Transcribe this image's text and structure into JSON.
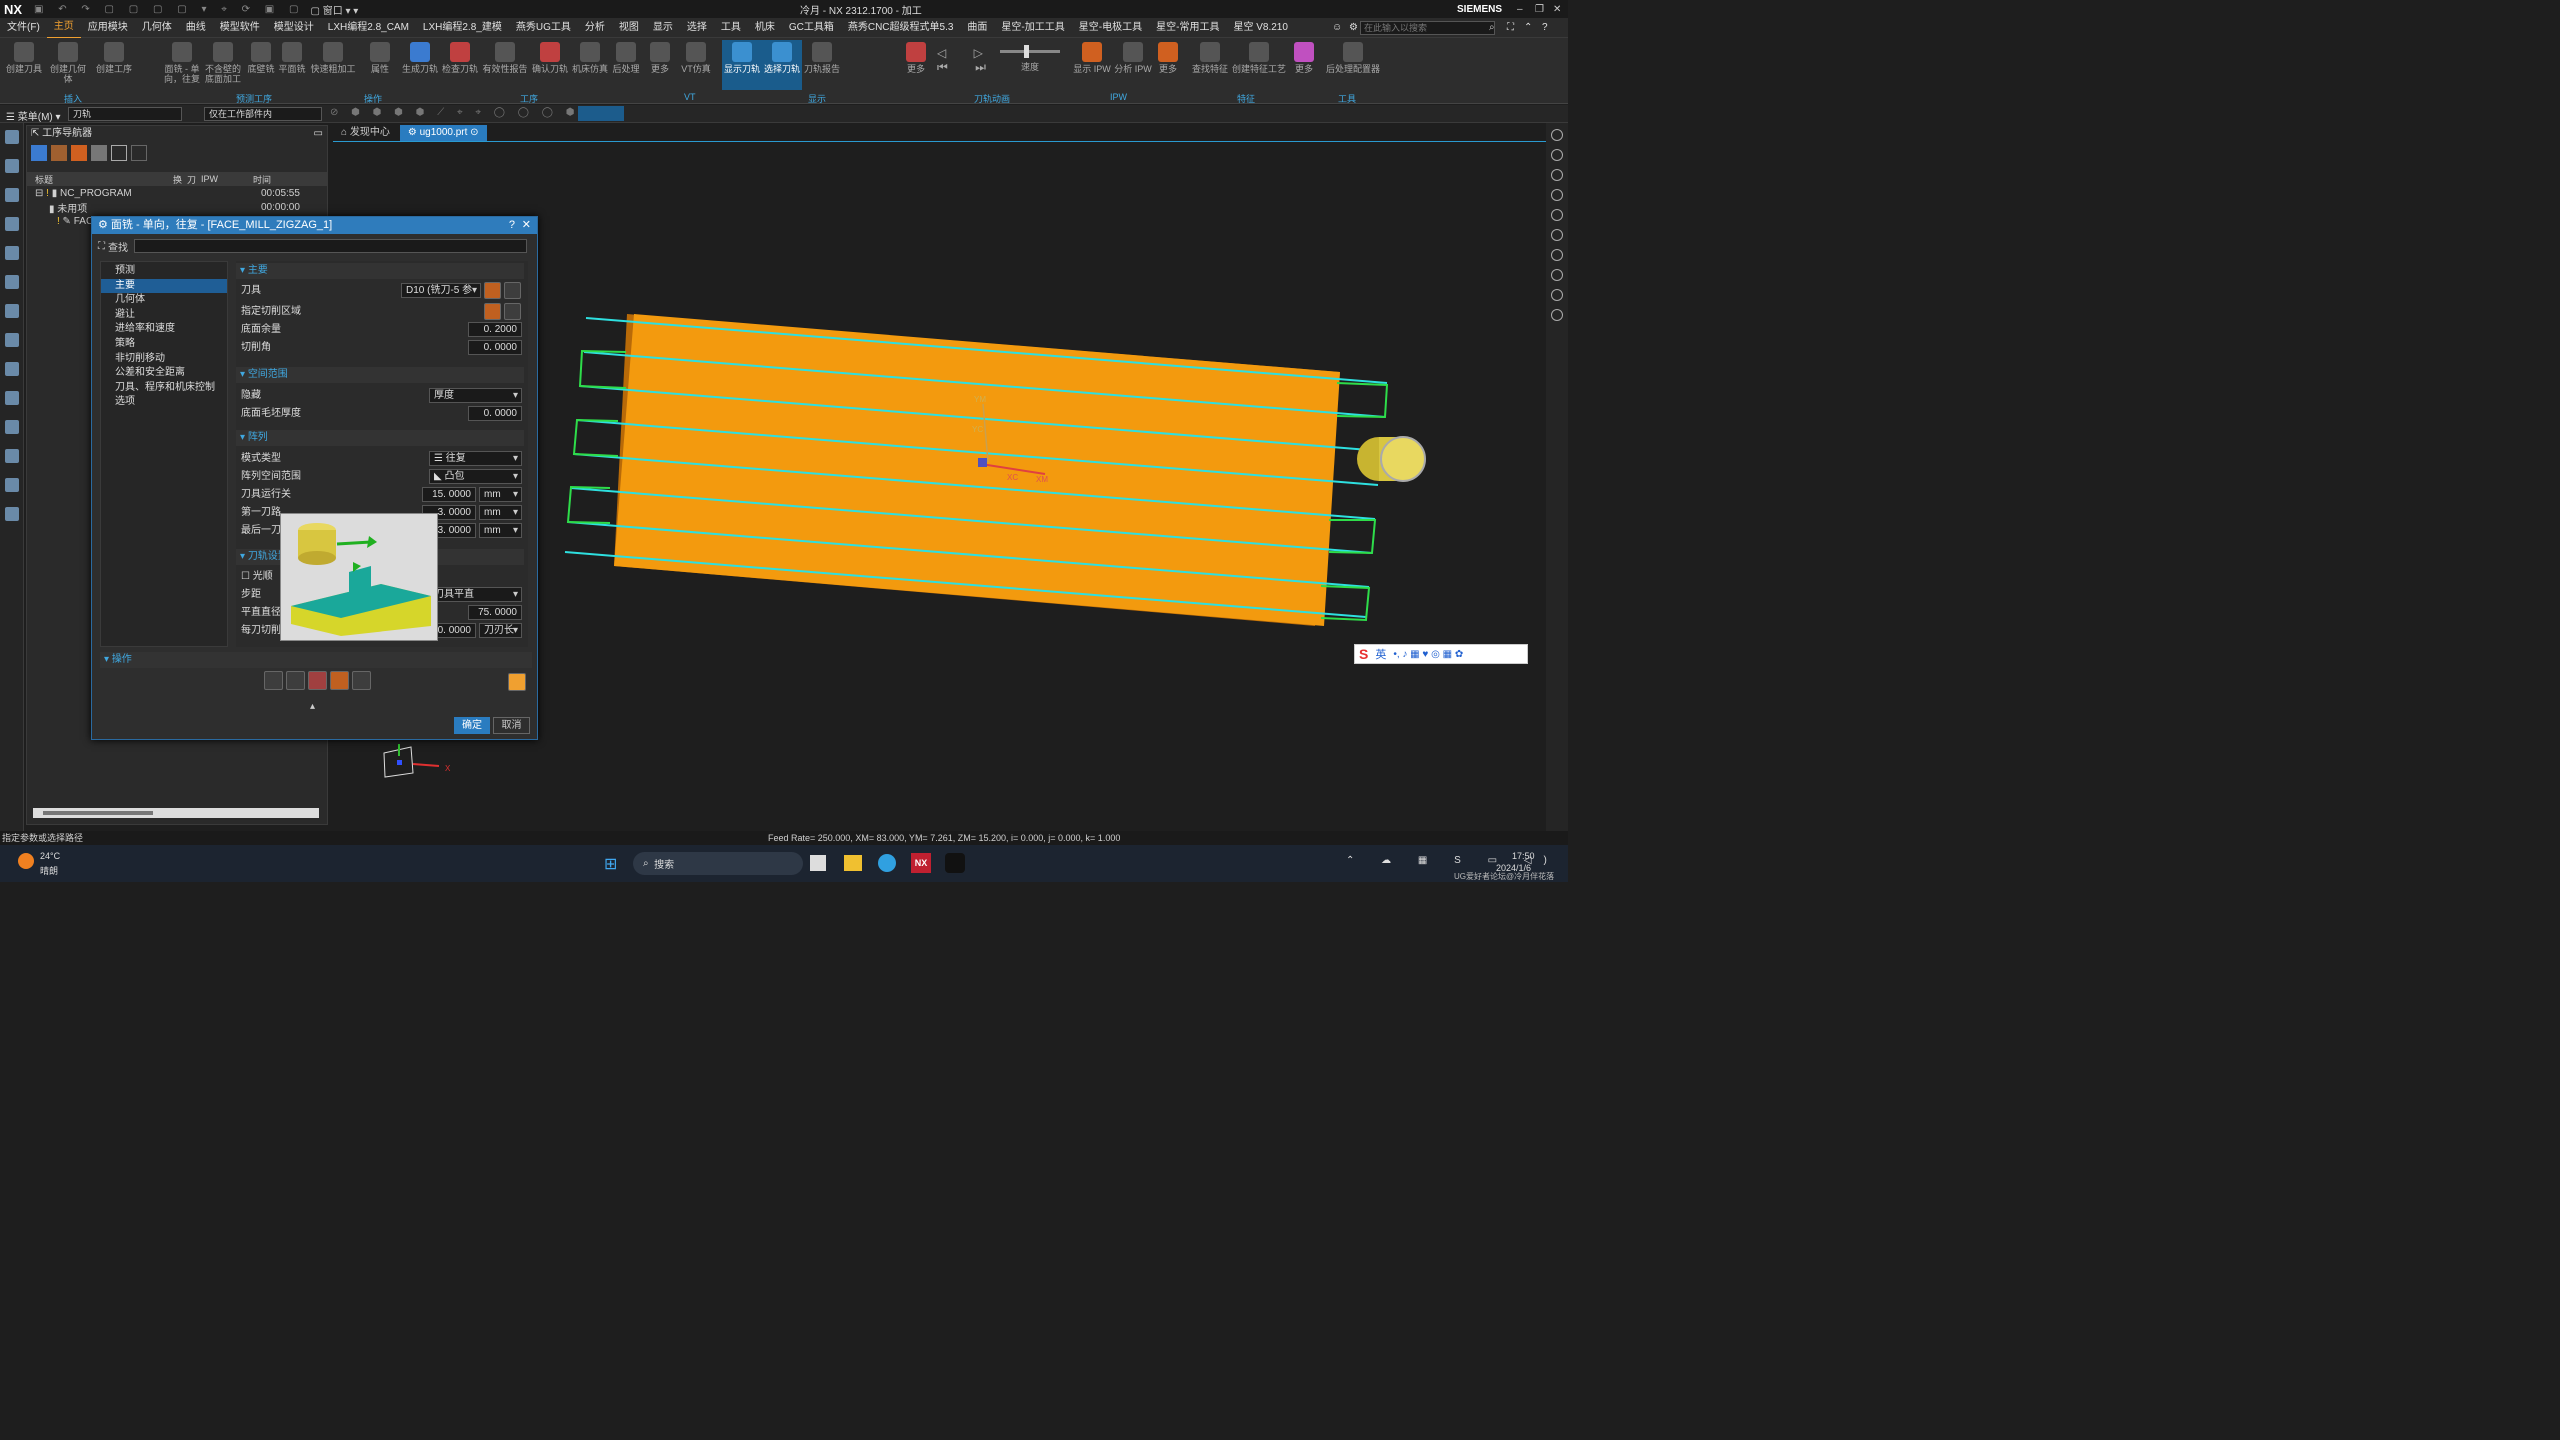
{
  "app": {
    "logo": "NX",
    "window_title": "冷月 - NX 2312.1700 - 加工",
    "brand": "SIEMENS",
    "search_placeholder": "在此输入以搜索"
  },
  "menubar": [
    "文件(F)",
    "主页",
    "应用模块",
    "几何体",
    "曲线",
    "模型软件",
    "模型设计",
    "LXH编程2.8_CAM",
    "LXH编程2.8_建模",
    "燕秀UG工具",
    "分析",
    "视图",
    "显示",
    "选择",
    "工具",
    "机床",
    "GC工具箱",
    "燕秀CNC超级程式单5.3",
    "曲面",
    "星空-加工工具",
    "星空-电极工具",
    "星空-常用工具",
    "星空 V8.210"
  ],
  "ribbon": {
    "buttons": [
      {
        "label": "创建刀具"
      },
      {
        "label": "创建几何体"
      },
      {
        "label": "创建工序"
      },
      {
        "label": "面铣 - 单向，往复"
      },
      {
        "label": "不含壁的底面加工"
      },
      {
        "label": "底壁铣"
      },
      {
        "label": "平面铣"
      },
      {
        "label": "快速粗加工"
      },
      {
        "label": "属性"
      },
      {
        "label": "生成刀轨"
      },
      {
        "label": "检查刀轨"
      },
      {
        "label": "有效性报告"
      },
      {
        "label": "确认刀轨"
      },
      {
        "label": "机床仿真"
      },
      {
        "label": "后处理"
      },
      {
        "label": "更多"
      },
      {
        "label": "VT仿真"
      },
      {
        "label": "显示刀轨"
      },
      {
        "label": "选择刀轨"
      },
      {
        "label": "刀轨报告"
      },
      {
        "label": "更多"
      },
      {
        "label": "速度"
      },
      {
        "label": "显示 IPW"
      },
      {
        "label": "分析 IPW"
      },
      {
        "label": "更多"
      },
      {
        "label": "查找特征"
      },
      {
        "label": "创建特征工艺"
      },
      {
        "label": "更多"
      },
      {
        "label": "后处理配置器"
      }
    ],
    "groups": [
      "插入",
      "预测工序",
      "操作",
      "工序",
      "VT",
      "显示",
      "刀轨动画",
      "IPW",
      "特征",
      "工具"
    ]
  },
  "toolbar2": {
    "menu_label": "菜单(M)",
    "filter_value": "刀轨",
    "scope_value": "仅在工作部件内"
  },
  "navigator": {
    "title": "工序导航器",
    "columns": [
      "标题",
      "换",
      "刀",
      "IPW",
      "时间"
    ],
    "rows": [
      {
        "name": "NC_PROGRAM",
        "time": "00:05:55"
      },
      {
        "name": "未用项",
        "time": "00:00:00"
      },
      {
        "name": "FAC",
        "time": ""
      }
    ]
  },
  "tabs": [
    {
      "label": "发现中心"
    },
    {
      "label": "ug1000.prt"
    }
  ],
  "dialog": {
    "title": "面铣 - 单向，往复 - [FACE_MILL_ZIGZAG_1]",
    "search_label": "查找",
    "tree": [
      "预测",
      "主要",
      "几何体",
      "避让",
      "进给率和速度",
      "策略",
      "非切削移动",
      "公差和安全距离",
      "刀具、程序和机床控制",
      "选项"
    ],
    "sections": {
      "main": "主要",
      "space": "空间范围",
      "array": "阵列",
      "toolpath": "刀轨设置",
      "ops": "操作"
    },
    "fields": {
      "tool_label": "刀具",
      "tool_value": "D10 (铣刀-5 参",
      "cut_area_label": "指定切削区域",
      "floor_stock_label": "底面余量",
      "floor_stock_value": "0. 2000",
      "cut_angle_label": "切削角",
      "cut_angle_value": "0. 0000",
      "hide_label": "隐藏",
      "hide_value": "厚度",
      "blank_label": "底面毛坯厚度",
      "blank_value": "0. 0000",
      "pattern_label": "模式类型",
      "pattern_value": "往复",
      "array_range_label": "阵列空间范围",
      "array_range_value": "凸包",
      "tool_run_label": "刀具运行关",
      "tool_run_value": "15. 0000",
      "tool_run_unit": "mm",
      "first_label": "第一刀路",
      "first_value": "3. 0000",
      "first_unit": "mm",
      "last_label": "最后一刀",
      "last_value": "3. 0000",
      "last_unit": "mm",
      "smooth_label": "光顺",
      "step_label": "步距",
      "step_value": "刀具平直",
      "flat_label": "平直直径",
      "flat_value": "75. 0000",
      "depth_label": "每刀切削",
      "depth_value": "0. 0000",
      "depth_unit": "刀刃长"
    },
    "ok": "确定",
    "cancel": "取消"
  },
  "viewport": {
    "axis_labels": {
      "ym": "YM",
      "yc": "YC",
      "xc": "XC",
      "xm": "XM",
      "x": "X"
    },
    "block_color": "#f39a0e",
    "path_color": "#2ee0e0",
    "edge_color": "#2edd4a"
  },
  "ime": {
    "label": "英"
  },
  "status": {
    "left": "指定参数或选择路径",
    "right": "Feed Rate= 250.000, XM= 83.000, YM= 7.261, ZM= 15.200, i= 0.000, j= 0.000, k= 1.000"
  },
  "taskbar": {
    "temp": "24°C",
    "weather": "晴朗",
    "search": "搜索",
    "time": "17:50",
    "date": "2024/1/6",
    "watermark": "UG爱好者论坛@冷月伴花落"
  }
}
